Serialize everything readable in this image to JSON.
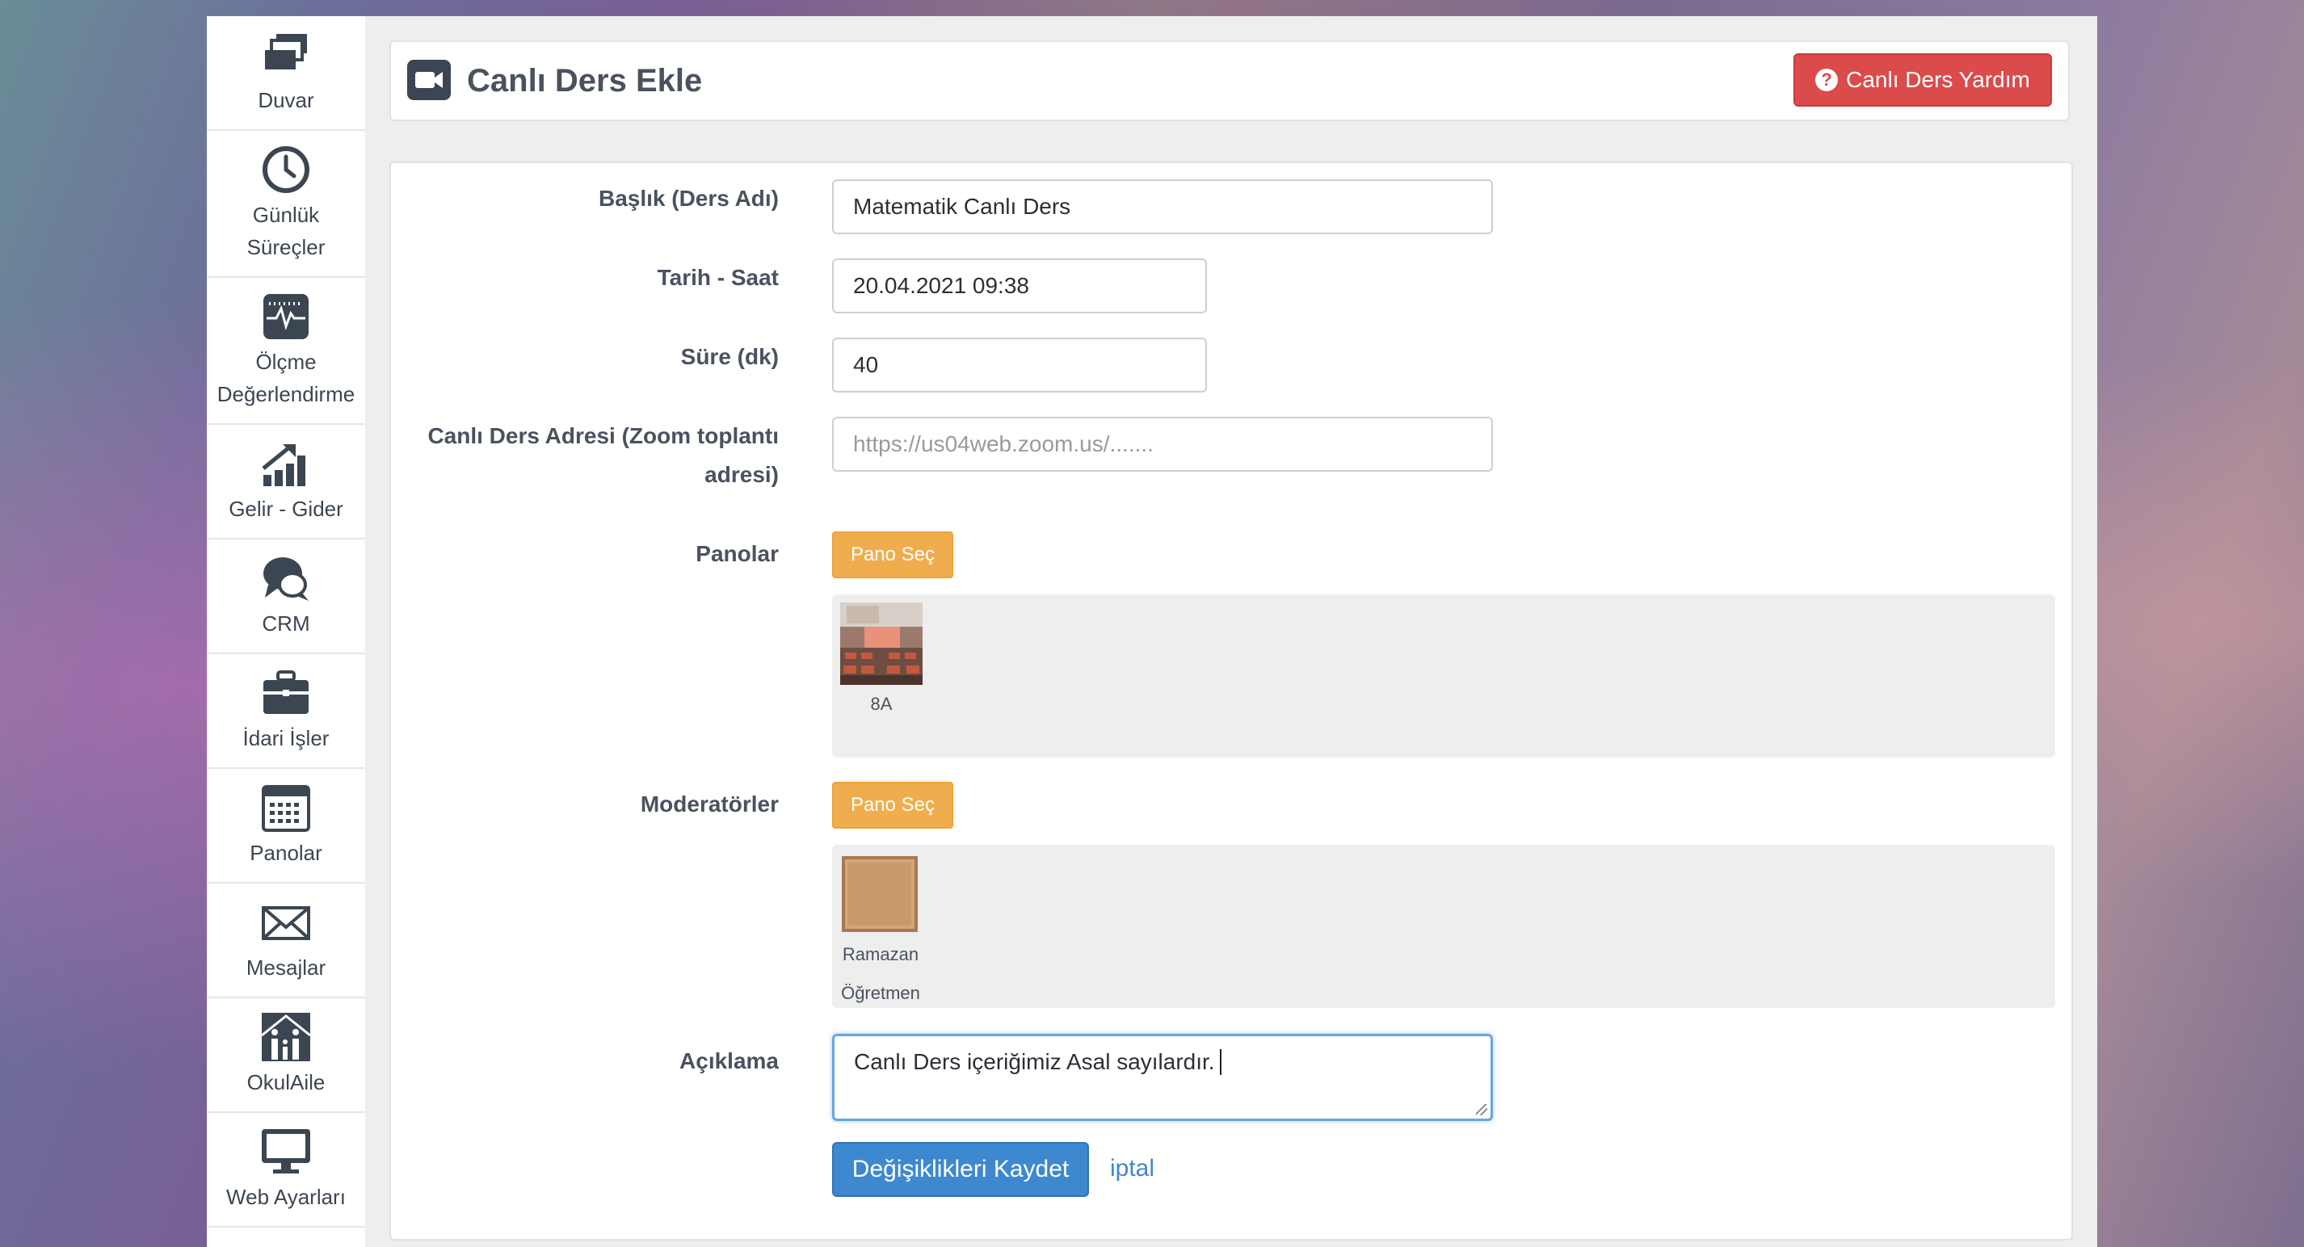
{
  "sidebar": {
    "items": [
      {
        "icon": "stack-icon",
        "label": "Duvar"
      },
      {
        "icon": "clock-icon",
        "label1": "Günlük",
        "label2": "Süreçler"
      },
      {
        "icon": "pulse-icon",
        "label1": "Ölçme",
        "label2": "Değerlendirme"
      },
      {
        "icon": "growth-chart-icon",
        "label": "Gelir - Gider"
      },
      {
        "icon": "chat-bubbles-icon",
        "label": "CRM"
      },
      {
        "icon": "briefcase-icon",
        "label": "İdari İşler"
      },
      {
        "icon": "calendar-icon",
        "label": "Panolar"
      },
      {
        "icon": "envelope-icon",
        "label": "Mesajlar"
      },
      {
        "icon": "family-icon",
        "label": "OkulAile"
      },
      {
        "icon": "monitor-icon",
        "label": "Web Ayarları"
      }
    ]
  },
  "header": {
    "icon": "video-camera-icon",
    "title": "Canlı Ders Ekle",
    "help_button": "Canlı Ders Yardım"
  },
  "form": {
    "title_label": "Başlık (Ders Adı)",
    "title_value": "Matematik Canlı Ders",
    "datetime_label": "Tarih - Saat",
    "datetime_value": "20.04.2021 09:38",
    "duration_label": "Süre (dk)",
    "duration_value": "40",
    "url_label1": "Canlı Ders Adresi (Zoom toplantı",
    "url_label2": "adresi)",
    "url_placeholder": "https://us04web.zoom.us/.......",
    "boards_label": "Panolar",
    "boards_button": "Pano Seç",
    "boards_selected": [
      {
        "name": "8A"
      }
    ],
    "moderators_label": "Moderatörler",
    "moderators_button": "Pano Seç",
    "moderators_selected": [
      {
        "name1": "Ramazan",
        "name2": "Öğretmen"
      }
    ],
    "description_label": "Açıklama",
    "description_value": "Canlı Ders içeriğimiz Asal sayılardır.",
    "save_button": "Değişiklikleri Kaydet",
    "cancel_link": "iptal"
  },
  "colors": {
    "primary": "#3e88cf",
    "danger": "#db4b4b",
    "warning": "#f0ad4e"
  }
}
